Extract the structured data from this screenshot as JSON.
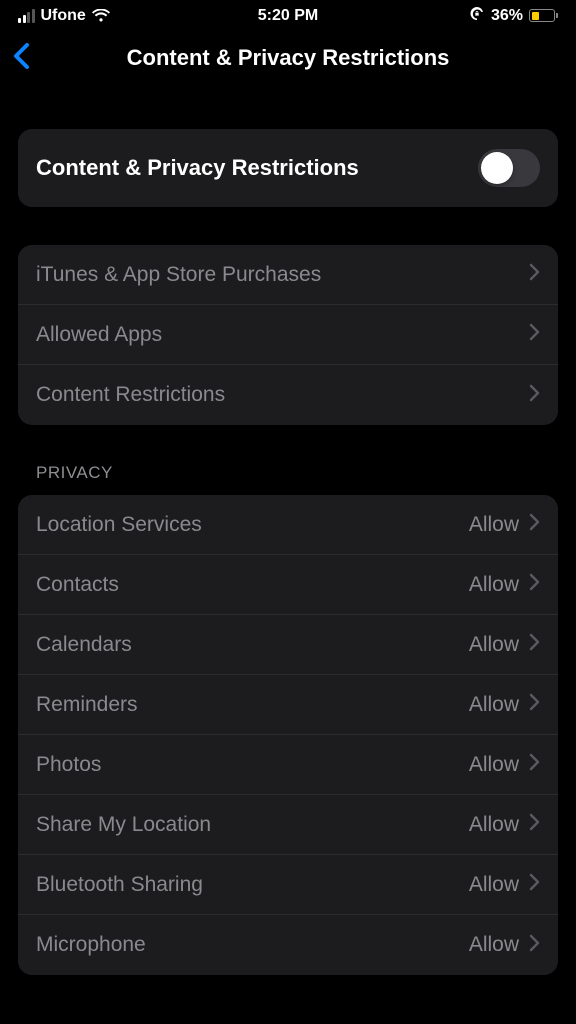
{
  "status_bar": {
    "carrier": "Ufone",
    "time": "5:20 PM",
    "battery_percent": "36%"
  },
  "header": {
    "title": "Content & Privacy Restrictions"
  },
  "main_toggle": {
    "label": "Content & Privacy Restrictions"
  },
  "group1": {
    "items": [
      {
        "label": "iTunes & App Store Purchases"
      },
      {
        "label": "Allowed Apps"
      },
      {
        "label": "Content Restrictions"
      }
    ]
  },
  "privacy": {
    "header": "PRIVACY",
    "allow_label": "Allow",
    "items": [
      {
        "label": "Location Services"
      },
      {
        "label": "Contacts"
      },
      {
        "label": "Calendars"
      },
      {
        "label": "Reminders"
      },
      {
        "label": "Photos"
      },
      {
        "label": "Share My Location"
      },
      {
        "label": "Bluetooth Sharing"
      },
      {
        "label": "Microphone"
      }
    ]
  }
}
